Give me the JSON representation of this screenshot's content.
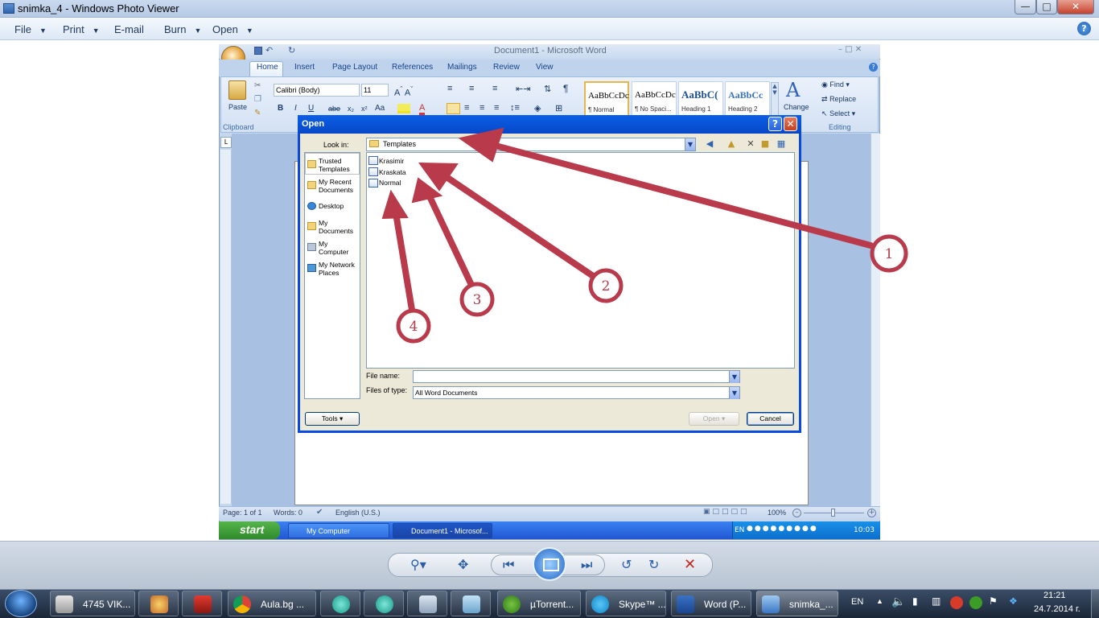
{
  "photo_viewer": {
    "title": "snimka_4 - Windows Photo Viewer",
    "menu": [
      "File",
      "Print",
      "E-mail",
      "Burn",
      "Open"
    ],
    "help_label": "?"
  },
  "word": {
    "title": "Document1 - Microsoft Word",
    "tabs": [
      "Home",
      "Insert",
      "Page Layout",
      "References",
      "Mailings",
      "Review",
      "View"
    ],
    "ribbon": {
      "paste": "Paste",
      "font_name": "Calibri (Body)",
      "font_size": "11",
      "clipboard_group": "Clipboard",
      "styles": [
        {
          "preview": "AaBbCcDc",
          "name": "¶ Normal"
        },
        {
          "preview": "AaBbCcDc",
          "name": "¶ No Spaci..."
        },
        {
          "preview": "AaBbC(",
          "name": "Heading 1"
        },
        {
          "preview": "AaBbCc",
          "name": "Heading 2"
        }
      ],
      "change_styles": "Change",
      "find": "Find",
      "replace": "Replace",
      "select": "Select",
      "editing_group": "Editing"
    },
    "status": {
      "page": "Page: 1 of 1",
      "words": "Words: 0",
      "language": "English (U.S.)",
      "zoom": "100%"
    }
  },
  "open_dialog": {
    "title": "Open",
    "look_in_label": "Look in:",
    "look_in_value": "Templates",
    "places": [
      "Trusted Templates",
      "My Recent Documents",
      "Desktop",
      "My Documents",
      "My Computer",
      "My Network Places"
    ],
    "files": [
      "Krasimir",
      "Kraskata",
      "Normal"
    ],
    "file_name_label": "File name:",
    "file_name_value": "",
    "files_of_type_label": "Files of type:",
    "files_of_type_value": "All Word Documents",
    "tools_label": "Tools",
    "open_label": "Open",
    "cancel_label": "Cancel"
  },
  "xp_taskbar": {
    "start": "start",
    "buttons": [
      "My Computer",
      "Document1 - Microsof..."
    ],
    "lang": "EN",
    "clock": "10:03"
  },
  "annotations": [
    "1",
    "2",
    "3",
    "4"
  ],
  "win7_taskbar": {
    "buttons": [
      "4745 VIK...",
      "Aula.bg ...",
      "µTorrent...",
      "Skype™ ...",
      "Word (P...",
      "snimka_..."
    ],
    "lang": "EN",
    "time": "21:21",
    "date": "24.7.2014 г."
  },
  "colors": {
    "annotation": "#b83a4b",
    "xp_blue": "#0a4ae0",
    "word_ribbon": "#d3e1f3"
  }
}
